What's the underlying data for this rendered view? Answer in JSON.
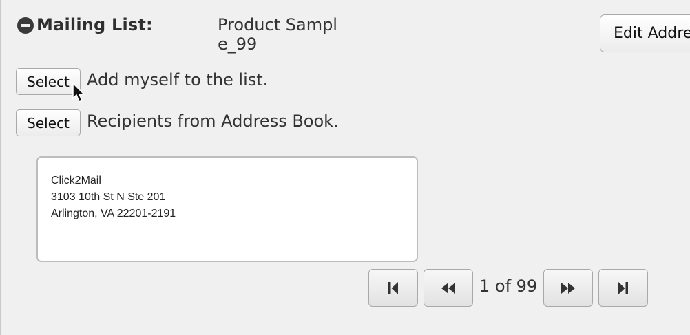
{
  "mailing_list": {
    "label": "Mailing List:",
    "value": "Product Sample_99",
    "edit_button_label": "Edit Address List"
  },
  "options": [
    {
      "button_label": "Select",
      "description": "Add myself to the list."
    },
    {
      "button_label": "Select",
      "description": "Recipients from Address Book."
    }
  ],
  "address": {
    "line1": "Click2Mail",
    "line2": "3103 10th St N Ste 201",
    "line3": "Arlington, VA 22201-2191"
  },
  "pager": {
    "status": "1 of 99",
    "icons": {
      "first": "first-page-icon",
      "prev": "previous-page-icon",
      "next": "next-page-icon",
      "last": "last-page-icon"
    }
  },
  "colors": {
    "background": "#f0f0f0",
    "button_border": "#a9a9a9",
    "text": "#333333"
  }
}
